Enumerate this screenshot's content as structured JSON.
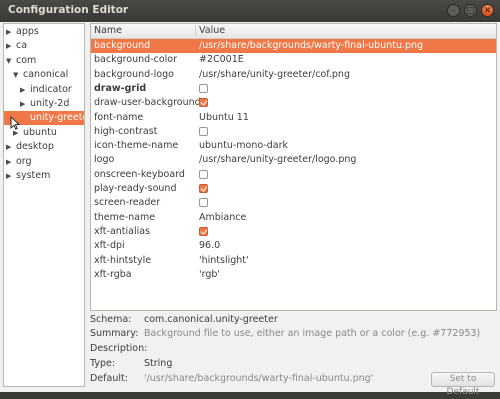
{
  "window": {
    "title": "Configuration Editor"
  },
  "tree": [
    {
      "label": "apps",
      "indent": 0,
      "expander": "collapsed"
    },
    {
      "label": "ca",
      "indent": 0,
      "expander": "collapsed"
    },
    {
      "label": "com",
      "indent": 0,
      "expander": "expanded"
    },
    {
      "label": "canonical",
      "indent": 1,
      "expander": "expanded"
    },
    {
      "label": "indicator",
      "indent": 2,
      "expander": "collapsed"
    },
    {
      "label": "unity-2d",
      "indent": 2,
      "expander": "collapsed"
    },
    {
      "label": "unity-greeter",
      "indent": 2,
      "expander": "none",
      "selected": true
    },
    {
      "label": "ubuntu",
      "indent": 1,
      "expander": "collapsed"
    },
    {
      "label": "desktop",
      "indent": 0,
      "expander": "collapsed"
    },
    {
      "label": "org",
      "indent": 0,
      "expander": "collapsed"
    },
    {
      "label": "system",
      "indent": 0,
      "expander": "collapsed"
    }
  ],
  "grid": {
    "headers": {
      "name": "Name",
      "value": "Value"
    },
    "rows": [
      {
        "name": "background",
        "type": "text",
        "value": "/usr/share/backgrounds/warty-final-ubuntu.png",
        "selected": true
      },
      {
        "name": "background-color",
        "type": "text",
        "value": "#2C001E"
      },
      {
        "name": "background-logo",
        "type": "text",
        "value": "/usr/share/unity-greeter/cof.png"
      },
      {
        "name": "draw-grid",
        "type": "bool",
        "checked": false,
        "bold": true
      },
      {
        "name": "draw-user-backgrounds",
        "type": "bool",
        "checked": true
      },
      {
        "name": "font-name",
        "type": "text",
        "value": "Ubuntu 11"
      },
      {
        "name": "high-contrast",
        "type": "bool",
        "checked": false
      },
      {
        "name": "icon-theme-name",
        "type": "text",
        "value": "ubuntu-mono-dark"
      },
      {
        "name": "logo",
        "type": "text",
        "value": "/usr/share/unity-greeter/logo.png"
      },
      {
        "name": "onscreen-keyboard",
        "type": "bool",
        "checked": false
      },
      {
        "name": "play-ready-sound",
        "type": "bool",
        "checked": true
      },
      {
        "name": "screen-reader",
        "type": "bool",
        "checked": false
      },
      {
        "name": "theme-name",
        "type": "text",
        "value": "Ambiance"
      },
      {
        "name": "xft-antialias",
        "type": "bool",
        "checked": true
      },
      {
        "name": "xft-dpi",
        "type": "text",
        "value": "96.0"
      },
      {
        "name": "xft-hintstyle",
        "type": "text",
        "value": "'hintslight'"
      },
      {
        "name": "xft-rgba",
        "type": "text",
        "value": "'rgb'"
      }
    ]
  },
  "info": {
    "schema_label": "Schema:",
    "schema": "com.canonical.unity-greeter",
    "summary_label": "Summary:",
    "summary": "Background file to use, either an image path or a color (e.g. #772953)",
    "description_label": "Description:",
    "description": "",
    "type_label": "Type:",
    "type": "String",
    "default_label": "Default:",
    "default": "'/usr/share/backgrounds/warty-final-ubuntu.png'",
    "reset_label": "Set to Default"
  },
  "colors": {
    "accent": "#f07746",
    "titlebar": "#3c3b37"
  }
}
